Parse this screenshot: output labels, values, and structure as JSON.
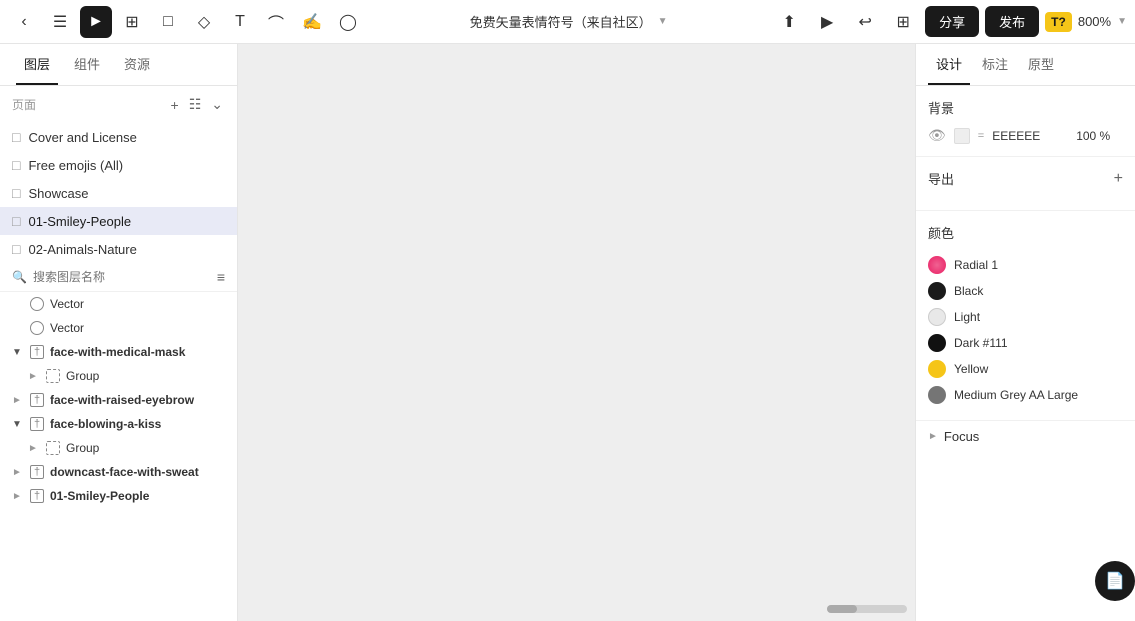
{
  "toolbar": {
    "title": "免费矢量表情符号（来自社区）",
    "dropdown_icon": "▾",
    "share_label": "分享",
    "publish_label": "发布",
    "zoom_badge": "T?",
    "zoom_level": "800%",
    "back_icon": "‹",
    "menu_icon": "☰",
    "select_icon": "▶",
    "crop_icon": "⊞",
    "rect_icon": "□",
    "pen_icon": "◇",
    "text_icon": "T",
    "node_icon": "⌒",
    "hand_icon": "✋",
    "comment_icon": "○",
    "upload_icon": "⬆",
    "play_icon": "▶",
    "preview_icon": "↩",
    "more_icon": "⊡"
  },
  "left_sidebar": {
    "tabs": [
      {
        "label": "图层",
        "active": true
      },
      {
        "label": "组件",
        "active": false
      },
      {
        "label": "资源",
        "active": false
      }
    ],
    "pages_label": "页面",
    "pages": [
      {
        "name": "Cover and License",
        "active": false
      },
      {
        "name": "Free emojis (All)",
        "active": false
      },
      {
        "name": "Showcase",
        "active": false
      },
      {
        "name": "01-Smiley-People",
        "active": true
      },
      {
        "name": "02-Animals-Nature",
        "active": false
      }
    ],
    "search_placeholder": "搜索图层名称",
    "layers": [
      {
        "name": "Vector",
        "type": "circle",
        "level": 0,
        "expanded": false
      },
      {
        "name": "Vector",
        "type": "circle",
        "level": 0,
        "expanded": false
      },
      {
        "name": "face-with-medical-mask",
        "type": "frame",
        "level": 0,
        "expanded": true,
        "bold": true
      },
      {
        "name": "Group",
        "type": "group",
        "level": 1,
        "expanded": false
      },
      {
        "name": "face-with-raised-eyebrow",
        "type": "frame",
        "level": 0,
        "expanded": false,
        "bold": true
      },
      {
        "name": "face-blowing-a-kiss",
        "type": "frame",
        "level": 0,
        "expanded": true,
        "bold": true
      },
      {
        "name": "Group",
        "type": "group",
        "level": 1,
        "expanded": false
      },
      {
        "name": "downcast-face-with-sweat",
        "type": "frame",
        "level": 0,
        "expanded": false,
        "bold": true
      },
      {
        "name": "01-Smiley-People",
        "type": "frame",
        "level": 0,
        "expanded": false,
        "bold": true
      }
    ]
  },
  "right_sidebar": {
    "tabs": [
      {
        "label": "设计",
        "active": true
      },
      {
        "label": "标注",
        "active": false
      },
      {
        "label": "原型",
        "active": false
      }
    ],
    "background_section": {
      "label": "背景",
      "color_hex": "EEEEEE",
      "opacity": "100 %"
    },
    "export_section": {
      "label": "导出"
    },
    "colors_section": {
      "label": "颜色",
      "colors": [
        {
          "name": "Radial 1",
          "color": "#F06292",
          "type": "radial"
        },
        {
          "name": "Black",
          "color": "#1a1a1a"
        },
        {
          "name": "Light",
          "color": "#e8e8e8"
        },
        {
          "name": "Dark #111",
          "color": "#111111"
        },
        {
          "name": "Yellow",
          "color": "#F5C518"
        },
        {
          "name": "Medium Grey AA Large",
          "color": "#757575"
        }
      ]
    },
    "focus_section": {
      "label": "Focus"
    }
  },
  "floating_btn": {
    "icon": "📄"
  }
}
